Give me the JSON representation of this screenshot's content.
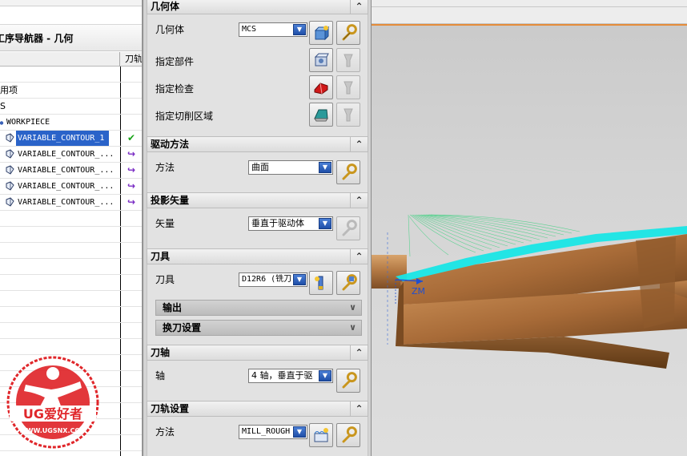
{
  "navigator": {
    "title": "工序导航器 - 几何",
    "column_tool": "刀轨",
    "rows": [
      {
        "label": "",
        "status": ""
      },
      {
        "label": "用项",
        "status": ""
      },
      {
        "label": "S",
        "status": ""
      },
      {
        "label": "WORKPIECE",
        "status": ""
      },
      {
        "label": "VARIABLE_CONTOUR_1",
        "status": "ok",
        "selected": true
      },
      {
        "label": "VARIABLE_CONTOUR_...",
        "status": "regenerate"
      },
      {
        "label": "VARIABLE_CONTOUR_...",
        "status": "regenerate"
      },
      {
        "label": "VARIABLE_CONTOUR_...",
        "status": "regenerate"
      },
      {
        "label": "VARIABLE_CONTOUR_...",
        "status": "regenerate"
      }
    ],
    "status_symbols": {
      "ok": "✔",
      "regenerate": "↪"
    }
  },
  "watermark": {
    "brand": "UG爱好者",
    "url": "WWW.UGSNX.COM",
    "color": "#e0262a"
  },
  "dialog": {
    "geometry": {
      "header": "几何体",
      "geometry_label": "几何体",
      "geometry_value": "MCS",
      "part_label": "指定部件",
      "check_label": "指定检查",
      "cut_area_label": "指定切削区域"
    },
    "drive": {
      "header": "驱动方法",
      "method_label": "方法",
      "method_value": "曲面"
    },
    "projection": {
      "header": "投影矢量",
      "vector_label": "矢量",
      "vector_value": "垂直于驱动体"
    },
    "tool": {
      "header": "刀具",
      "tool_label": "刀具",
      "tool_value": "D12R6 (铣刀",
      "output_label": "输出",
      "toolchange_label": "换刀设置"
    },
    "axis": {
      "header": "刀轴",
      "axis_label": "轴",
      "axis_value": "4 轴，垂直于驱"
    },
    "path": {
      "header": "刀轨设置",
      "method_label": "方法",
      "method_value": "MILL_ROUGH"
    }
  },
  "graphics": {
    "axis_label": "ZM",
    "colors": {
      "part": "#b87a45",
      "toolpath": "#19e6e6",
      "toolpath_fan": "#4fd18a",
      "accent": "#e58c3a"
    }
  }
}
